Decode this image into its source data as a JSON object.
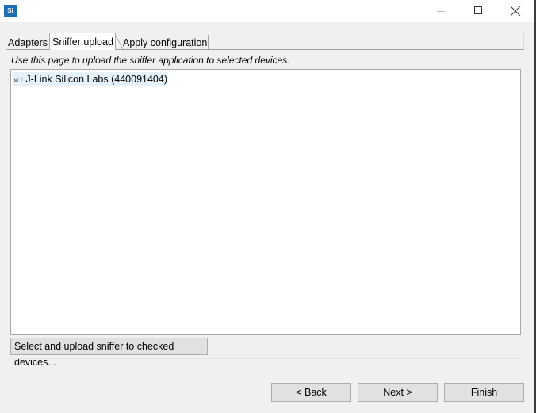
{
  "window": {
    "logo_text": "Si",
    "icons": [
      "minimize-icon",
      "maximize-icon",
      "close-icon"
    ]
  },
  "tabs": [
    {
      "label": "Adapters",
      "active": false
    },
    {
      "label": "Sniffer upload",
      "active": true
    },
    {
      "label": "Apply configuration",
      "active": false
    }
  ],
  "main": {
    "instructions": "Use this page to upload the sniffer application to selected devices.",
    "devices": [
      {
        "label": "J-Link Silicon Labs (440091404)",
        "checked": true,
        "icon": "usb-icon"
      }
    ],
    "upload_button": "Select and upload sniffer to checked devices..."
  },
  "footer": {
    "back": "< Back",
    "next": "Next >",
    "finish": "Finish"
  },
  "colors": {
    "logo": "#1c6fb7",
    "selection": "#e5f1fb",
    "button_bg": "#e1e1e1"
  }
}
